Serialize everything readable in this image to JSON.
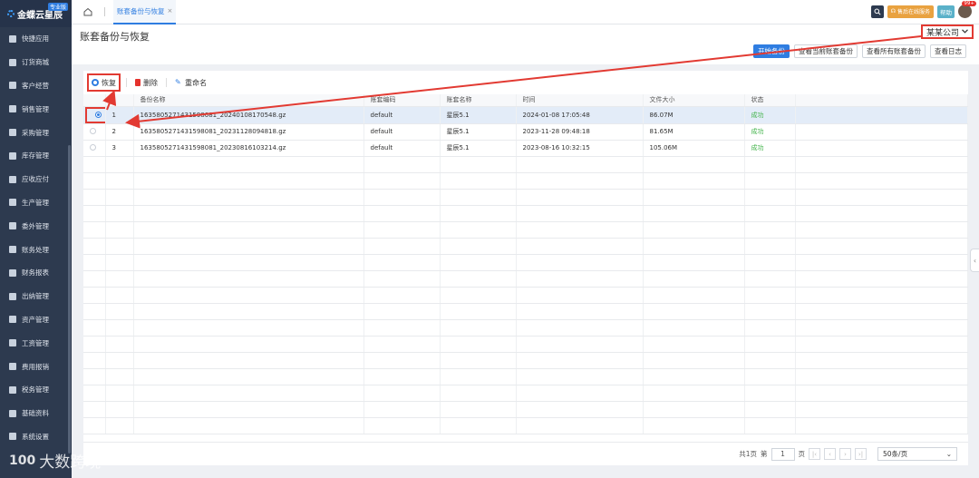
{
  "brand": {
    "name": "金蝶云星辰",
    "badge": "专业版"
  },
  "sidebar": {
    "items": [
      {
        "label": "快捷应用"
      },
      {
        "label": "订货商城"
      },
      {
        "label": "客户经营"
      },
      {
        "label": "销售管理"
      },
      {
        "label": "采购管理"
      },
      {
        "label": "库存管理"
      },
      {
        "label": "应收应付"
      },
      {
        "label": "生产管理"
      },
      {
        "label": "委外管理"
      },
      {
        "label": "账务处理"
      },
      {
        "label": "财务报表"
      },
      {
        "label": "出纳管理"
      },
      {
        "label": "资产管理"
      },
      {
        "label": "工资管理"
      },
      {
        "label": "费用报销"
      },
      {
        "label": "税务管理"
      },
      {
        "label": "基础资料"
      },
      {
        "label": "系统设置"
      }
    ]
  },
  "topbar": {
    "tab_label": "账套备份与恢复",
    "tab_close": "×",
    "service_label": "售后在线服务",
    "help_label": "帮助",
    "badge_count": "99+"
  },
  "page": {
    "title": "账套备份与恢复",
    "company": "某某公司",
    "buttons": {
      "start_backup": "开始备份",
      "view_current": "查看当前账套备份",
      "view_all": "查看所有账套备份",
      "view_log": "查看日志"
    }
  },
  "toolbar": {
    "restore": "恢复",
    "delete": "删除",
    "rename": "重命名"
  },
  "table": {
    "headers": {
      "name": "备份名称",
      "code": "账套编码",
      "acct_name": "账套名称",
      "time": "时间",
      "size": "文件大小",
      "status": "状态"
    },
    "rows": [
      {
        "index": "1",
        "name": "1635805271431598081_20240108170548.gz",
        "code": "default",
        "acct_name": "星辰5.1",
        "time": "2024-01-08 17:05:48",
        "size": "86.07M",
        "status": "成功",
        "selected": true
      },
      {
        "index": "2",
        "name": "1635805271431598081_20231128094818.gz",
        "code": "default",
        "acct_name": "星辰5.1",
        "time": "2023-11-28 09:48:18",
        "size": "81.65M",
        "status": "成功",
        "selected": false
      },
      {
        "index": "3",
        "name": "1635805271431598081_20230816103214.gz",
        "code": "default",
        "acct_name": "星辰5.1",
        "time": "2023-08-16 10:32:15",
        "size": "105.06M",
        "status": "成功",
        "selected": false
      }
    ]
  },
  "pager": {
    "total": "共1页",
    "page_prefix": "第",
    "page_value": "1",
    "page_suffix": "页",
    "page_size": "50条/页"
  },
  "watermark": {
    "text": "大数跨境",
    "mark": "100"
  },
  "colors": {
    "accent": "#2f7de1",
    "sidebar": "#2d3a4f",
    "annotation": "#e23a32",
    "success": "#42b34a"
  }
}
